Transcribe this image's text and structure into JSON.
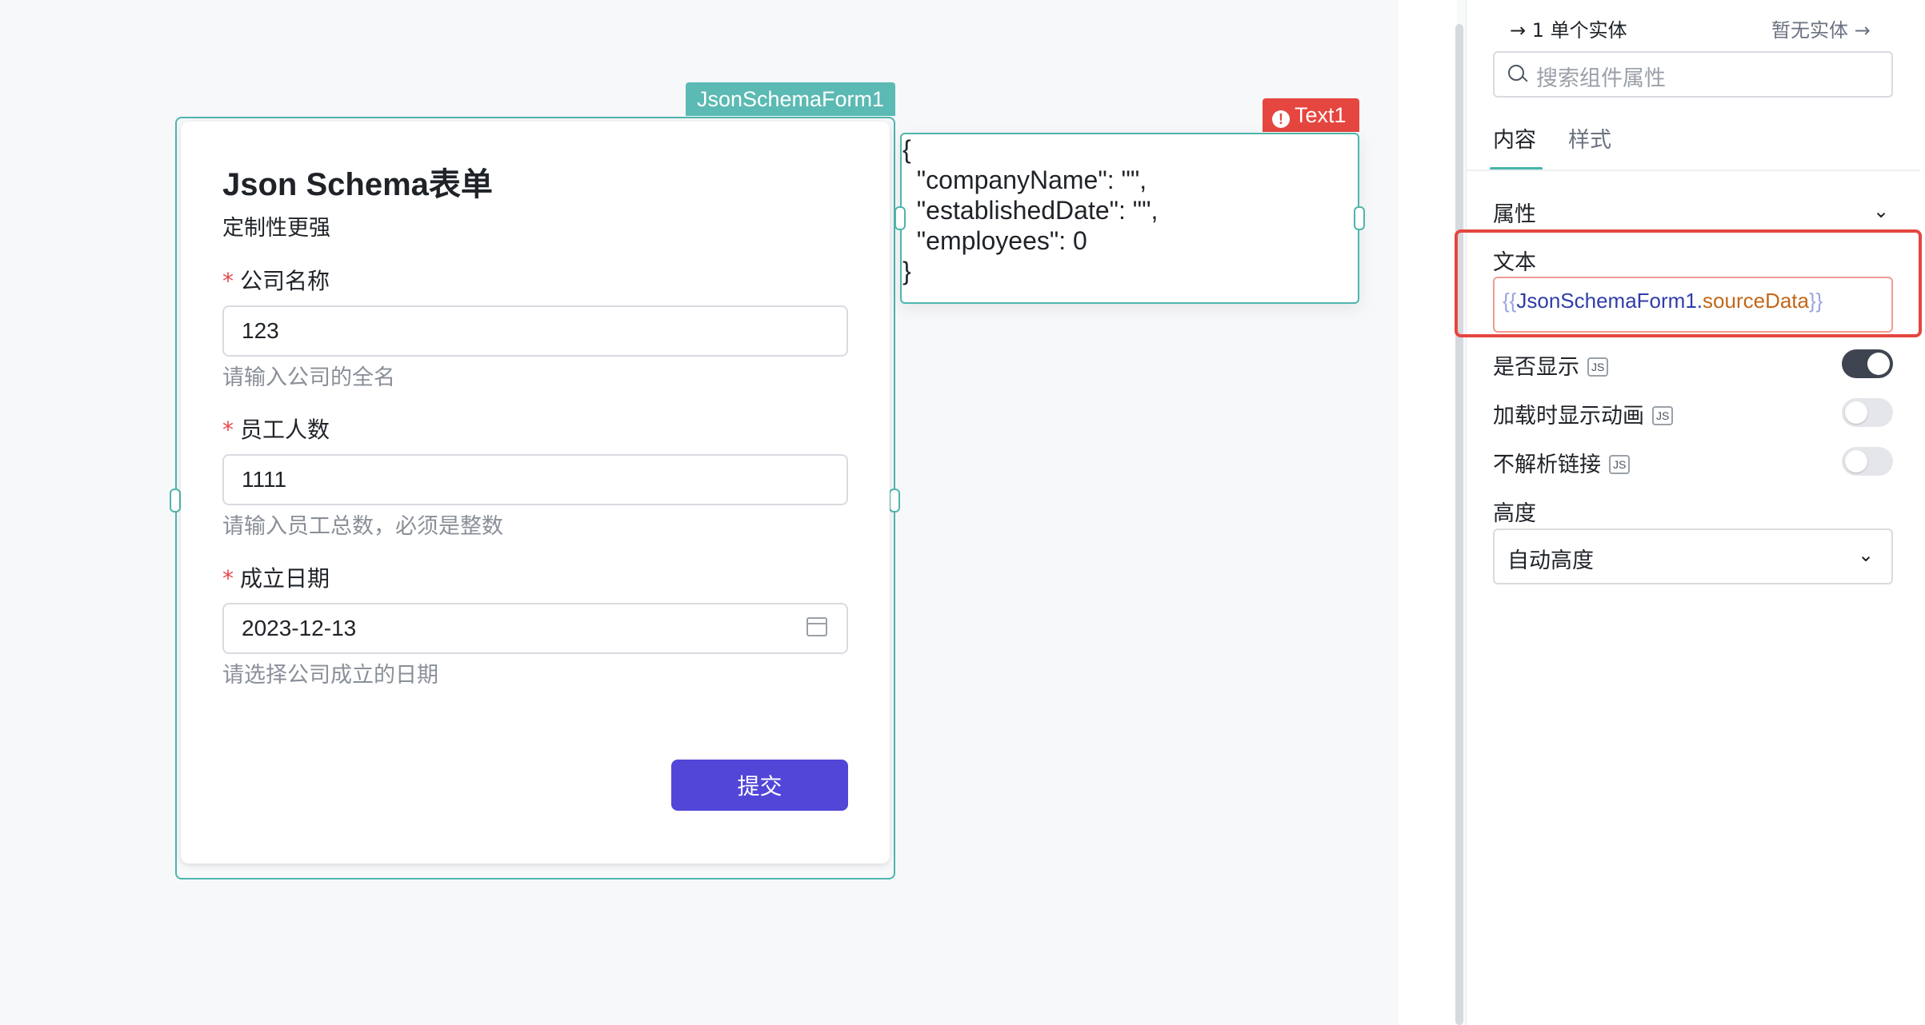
{
  "form_widget": {
    "tag": "JsonSchemaForm1",
    "title": "Json Schema表单",
    "subtitle": "定制性更强",
    "fields": [
      {
        "label": "公司名称",
        "value": "123",
        "hint": "请输入公司的全名"
      },
      {
        "label": "员工人数",
        "value": "1111",
        "hint": "请输入员工总数，必须是整数"
      },
      {
        "label": "成立日期",
        "value": "2023-12-13",
        "hint": "请选择公司成立的日期"
      }
    ],
    "required_mark": "*",
    "submit_label": "提交"
  },
  "text_widget": {
    "tag": "Text1",
    "error_icon": "!",
    "content": "{\n  \"companyName\": \"\",\n  \"establishedDate\": \"\",\n  \"employees\": 0\n}"
  },
  "panel": {
    "entity_prev": "→ 1 单个实体",
    "entity_next": "暂无实体 →",
    "search_placeholder": "搜索组件属性",
    "tabs": [
      "内容",
      "样式"
    ],
    "section_title": "属性",
    "section_chevron": "⌄",
    "text_prop": {
      "label": "文本",
      "open_brace": "{{",
      "ident": "JsonSchemaForm1",
      "dot": ".",
      "prop": "sourceData",
      "close_brace": "}}"
    },
    "options": [
      {
        "label": "是否显示",
        "badge": "JS",
        "enabled": true
      },
      {
        "label": "加载时显示动画",
        "badge": "JS",
        "enabled": false
      },
      {
        "label": "不解析链接",
        "badge": "JS",
        "enabled": false
      }
    ],
    "height": {
      "label": "高度",
      "value": "自动高度",
      "chevron": "⌄"
    }
  },
  "colors": {
    "accent_teal": "#4fb5ad",
    "submit_purple": "#5146d8",
    "error_red": "#e5463f"
  }
}
